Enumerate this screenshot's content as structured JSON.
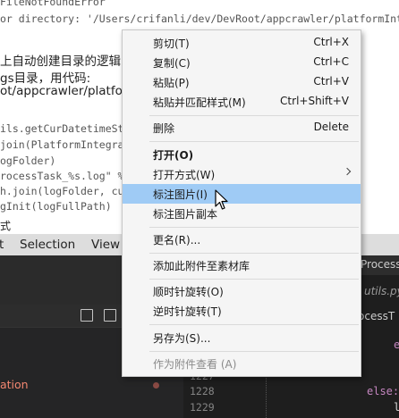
{
  "doc": {
    "lines": [
      "FileNotFoundError",
      "or directory: '/Users/crifanli/dev/DevRoot/appcrawler/platformIntegrat",
      "上自动创建目录的逻辑",
      "gs目录，用代码:",
      "ot/appcrawler/platfor",
      "ils.getCurDatetimeStr",
      "join(PlatformIntegrat",
      "ogFolder)",
      "rocessTask_%s.log\" % c",
      "h.join(logFolder, cu",
      "gInit(logFullPath)",
      "式"
    ]
  },
  "menubar": {
    "items": [
      "t",
      "Selection",
      "View"
    ]
  },
  "editor": {
    "right_tab_label": "Process",
    "right_file_label": "utils.py",
    "right_breadcrumb": "ocessT",
    "sidebar_text": "ation",
    "line_numbers": [
      "1227",
      "1228",
      "1229"
    ],
    "code_keyword_else": "else:",
    "code_char_e": "e",
    "code_char_l": "l"
  },
  "context_menu": {
    "items": [
      {
        "label": "剪切(T)",
        "shortcut": "Ctrl+X"
      },
      {
        "label": "复制(C)",
        "shortcut": "Ctrl+C"
      },
      {
        "label": "粘贴(P)",
        "shortcut": "Ctrl+V"
      },
      {
        "label": "粘贴并匹配样式(M)",
        "shortcut": "Ctrl+Shift+V"
      },
      {
        "label": "删除",
        "shortcut": "Delete"
      },
      {
        "label": "打开(O)",
        "shortcut": ""
      },
      {
        "label": "打开方式(W)",
        "shortcut": ""
      },
      {
        "label": "标注图片(I)",
        "shortcut": ""
      },
      {
        "label": "标注图片副本",
        "shortcut": ""
      },
      {
        "label": "更名(R)...",
        "shortcut": ""
      },
      {
        "label": "添加此附件至素材库",
        "shortcut": ""
      },
      {
        "label": "顺时针旋转(O)",
        "shortcut": ""
      },
      {
        "label": "逆时针旋转(T)",
        "shortcut": ""
      },
      {
        "label": "另存为(S)...",
        "shortcut": ""
      },
      {
        "label": "作为附件查看 (A)",
        "shortcut": ""
      }
    ],
    "highlighted_item": "标注图片(I)",
    "highlight_color": "#9fcbf5"
  }
}
